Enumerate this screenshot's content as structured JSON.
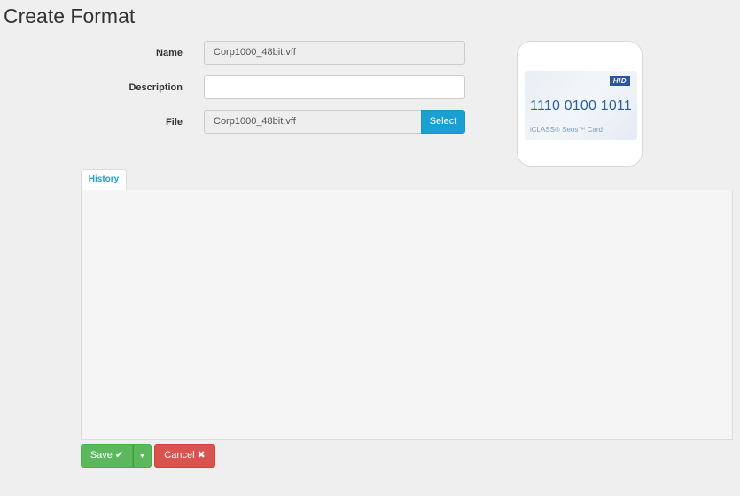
{
  "page": {
    "title": "Create Format"
  },
  "form": {
    "name_label": "Name",
    "name_value": "Corp1000_48bit.vff",
    "description_label": "Description",
    "description_value": "",
    "file_label": "File",
    "file_value": "Corp1000_48bit.vff",
    "select_label": "Select"
  },
  "card_preview": {
    "brand": "HID",
    "number": "1110 0100 1011",
    "card_type": "iCLASS® Seos™ Card"
  },
  "tabs": [
    {
      "label": "History",
      "active": true
    }
  ],
  "actions": {
    "save_label": "Save",
    "save_icon": "check-icon",
    "save_icon_glyph": "✔",
    "caret_icon": "caret-down-icon",
    "caret_glyph": "▼",
    "cancel_label": "Cancel",
    "cancel_icon": "times-icon",
    "cancel_icon_glyph": "✖"
  },
  "colors": {
    "accent": "#1ba1d1",
    "success": "#5cb85c",
    "danger": "#d9534f",
    "background": "#efefef"
  }
}
